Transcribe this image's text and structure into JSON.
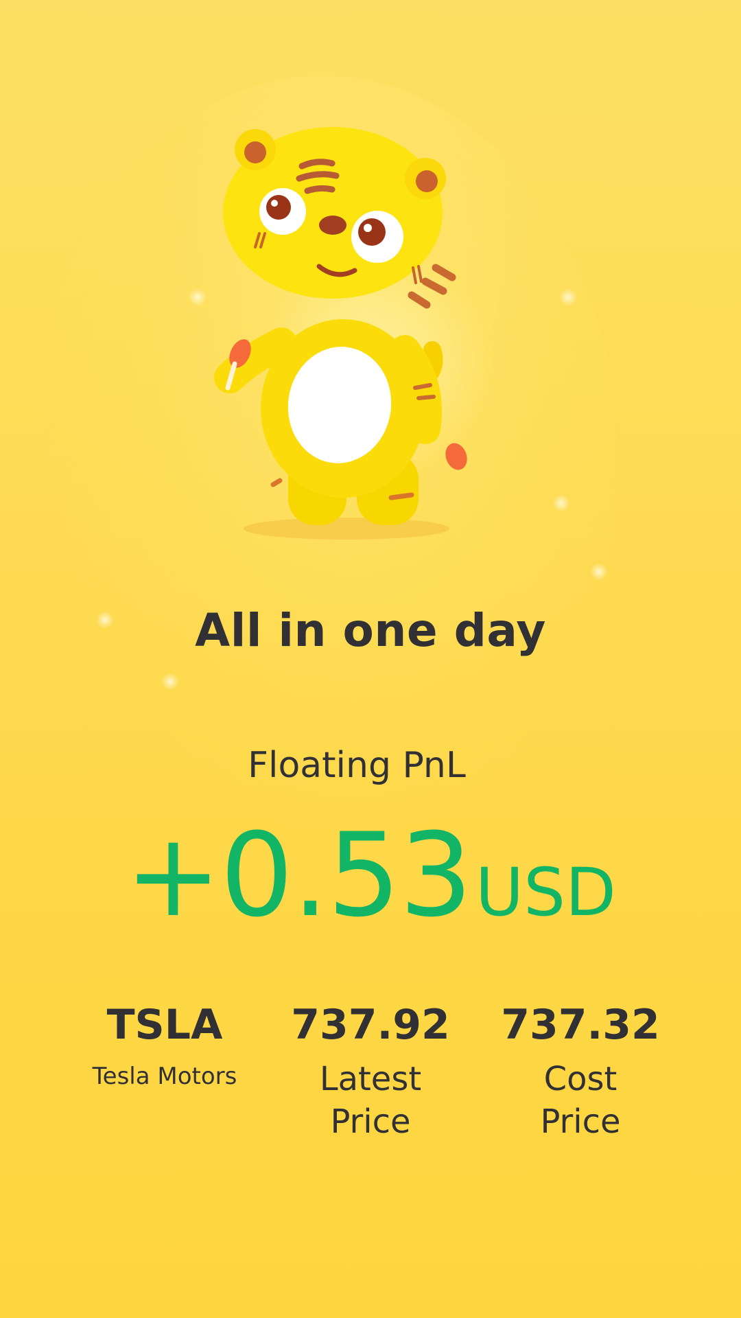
{
  "headline": "All in one day",
  "pnl": {
    "label": "Floating PnL",
    "value": "+0.53",
    "unit": "USD"
  },
  "stats": [
    {
      "value": "TSLA",
      "label": "Tesla Motors"
    },
    {
      "value": "737.92",
      "label": "Latest Price"
    },
    {
      "value": "737.32",
      "label": "Cost Price"
    }
  ],
  "mascot": {
    "icon": "tiger-mascot-icon"
  },
  "colors": {
    "background": "#fed84a",
    "text": "#303035",
    "gain": "#12b565"
  }
}
